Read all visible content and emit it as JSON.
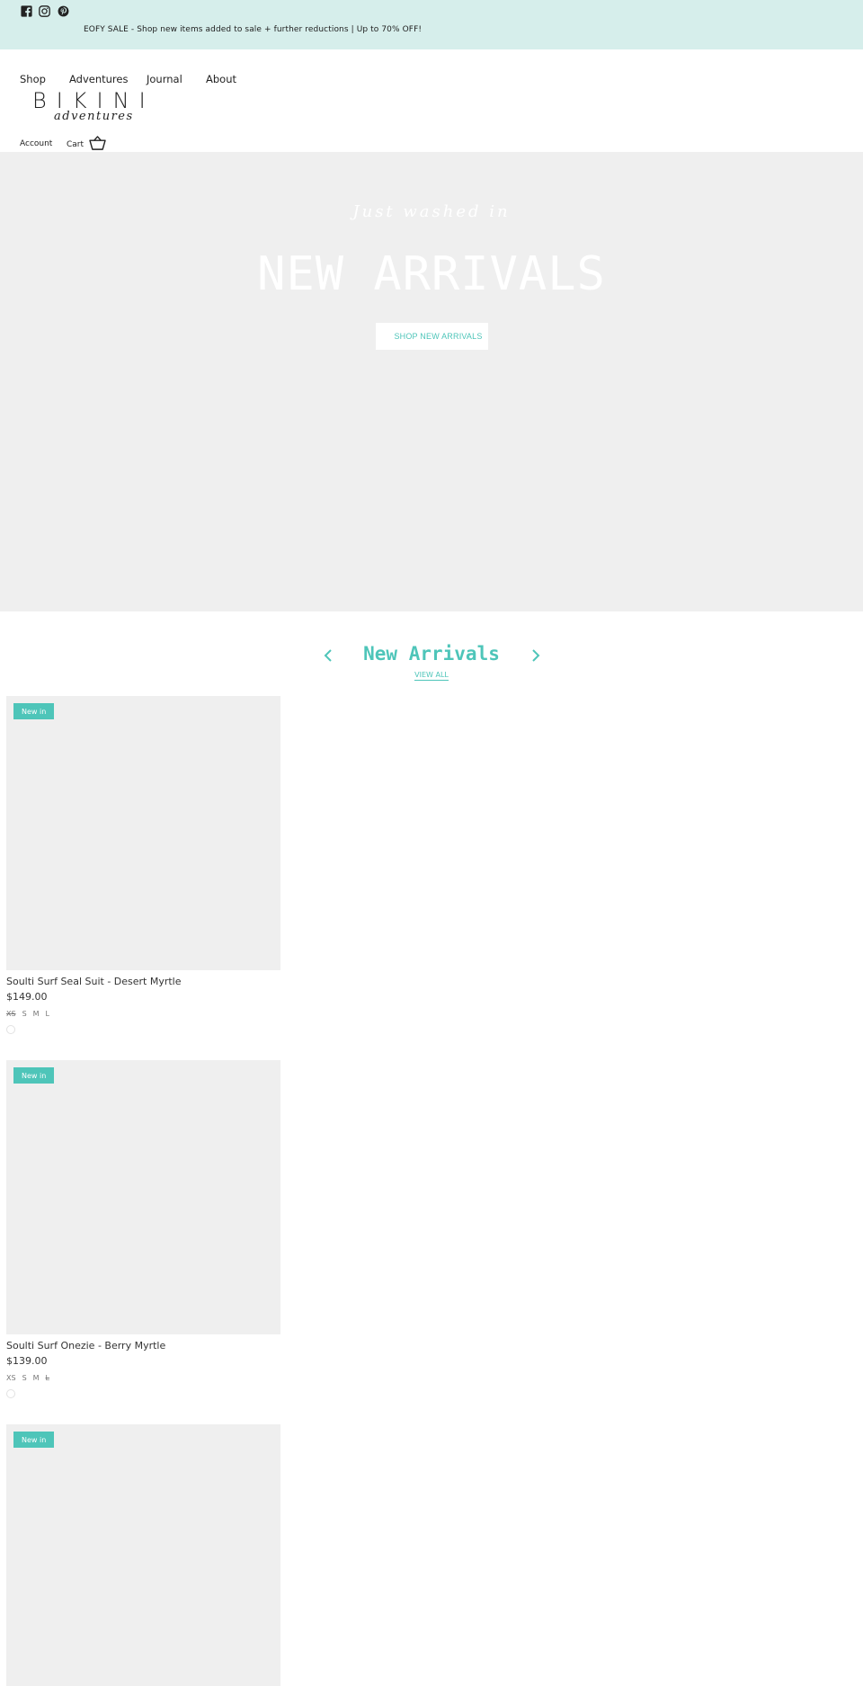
{
  "announcement": {
    "text": "EOFY SALE - Shop new items added to sale + further reductions | Up to 70% OFF!",
    "social_icons": [
      "facebook-icon",
      "instagram-icon",
      "pinterest-icon"
    ]
  },
  "nav": {
    "items": [
      {
        "label": "Shop"
      },
      {
        "label": "Adventures"
      },
      {
        "label": "Journal"
      },
      {
        "label": "About"
      }
    ]
  },
  "logo": {
    "main": "BIKINI",
    "sub": "adventures"
  },
  "header": {
    "account_label": "Account",
    "cart_label": "Cart"
  },
  "hero": {
    "subtitle": "Just washed in",
    "title": "NEW ARRIVALS",
    "button_label": "SHOP NEW ARRIVALS"
  },
  "section": {
    "title": "New Arrivals",
    "view_all": "VIEW ALL"
  },
  "products": [
    {
      "badge": "New in",
      "name": "Soulti Surf Seal Suit - Desert Myrtle",
      "price": "$149.00",
      "sizes": [
        {
          "label": "XS",
          "available": false
        },
        {
          "label": "S",
          "available": true
        },
        {
          "label": "M",
          "available": true
        },
        {
          "label": "L",
          "available": true
        }
      ]
    },
    {
      "badge": "New in",
      "name": "Soulti Surf Onezie - Berry Myrtle",
      "price": "$139.00",
      "sizes": [
        {
          "label": "XS",
          "available": true
        },
        {
          "label": "S",
          "available": true
        },
        {
          "label": "M",
          "available": true
        },
        {
          "label": "L",
          "available": false
        }
      ]
    },
    {
      "badge": "New in"
    }
  ],
  "colors": {
    "accent": "#4ec5b9",
    "announcement_bg": "#d6eeeb",
    "hero_bg": "#efefef",
    "placeholder_bg": "#efefef"
  }
}
